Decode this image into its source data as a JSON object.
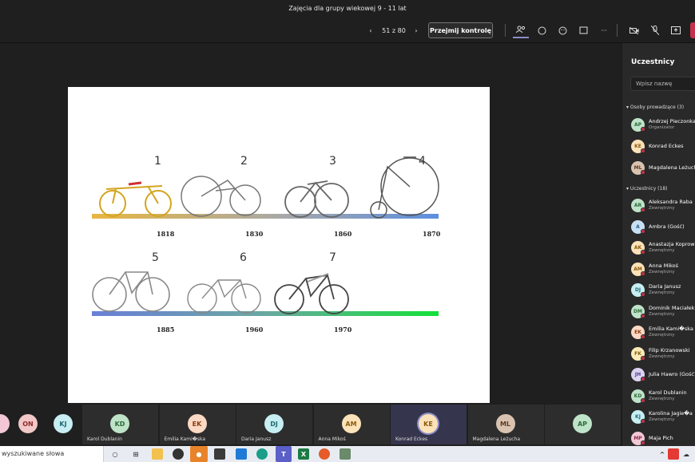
{
  "window": {
    "title": "Zajęcia dla grupy wiekowej 9 - 11 lat"
  },
  "toolbar": {
    "page_counter": "51 z 80",
    "takeover_label": "Przejmij kontrolę",
    "more_label": "···"
  },
  "slide": {
    "numbers": [
      "1",
      "2",
      "3",
      "4",
      "5",
      "6",
      "7"
    ],
    "years": [
      "1818",
      "1830",
      "1860",
      "1870",
      "1885",
      "1960",
      "1970"
    ]
  },
  "panel": {
    "title": "Uczestnicy",
    "search_placeholder": "Wpisz nazwę",
    "presenters_label": "Osoby prowadzące (3)",
    "attendees_label": "Uczestnicy (18)",
    "presenters": [
      {
        "initials": "AP",
        "name": "Andrzej Pieczonka",
        "sub": "Organizator",
        "color": "#bfe3c8",
        "fg": "#2d6b3c"
      },
      {
        "initials": "KE",
        "name": "Konrad Eckes",
        "sub": "",
        "color": "#fce2b8",
        "fg": "#8a5a10"
      },
      {
        "initials": "ML",
        "name": "Magdalena Leżuch",
        "sub": "",
        "color": "#d9c3b0",
        "fg": "#5a3a20"
      }
    ],
    "attendees": [
      {
        "initials": "AR",
        "name": "Aleksandra Raba",
        "sub": "Zewnętrzny",
        "color": "#bfe3c8",
        "fg": "#2d6b3c"
      },
      {
        "initials": "A",
        "name": "Ambra (Gość)",
        "sub": "",
        "color": "#c7dff2",
        "fg": "#2a5f8f"
      },
      {
        "initials": "AK",
        "name": "Anastazja Koprow",
        "sub": "Zewnętrzny",
        "color": "#fce2b8",
        "fg": "#8a5a10"
      },
      {
        "initials": "AM",
        "name": "Anna Mikoś",
        "sub": "Zewnętrzny",
        "color": "#fce2b8",
        "fg": "#8a5a10"
      },
      {
        "initials": "DJ",
        "name": "Daria Janusz",
        "sub": "Zewnętrzny",
        "color": "#c7eef2",
        "fg": "#1f6a73"
      },
      {
        "initials": "DM",
        "name": "Dominik Maciałek",
        "sub": "Zewnętrzny",
        "color": "#bfe3c8",
        "fg": "#2d6b3c"
      },
      {
        "initials": "EK",
        "name": "Emilia Kami�ska",
        "sub": "Zewnętrzny",
        "color": "#fcd9c4",
        "fg": "#8a3c10"
      },
      {
        "initials": "FK",
        "name": "Filip Krzanowski",
        "sub": "Zewnętrzny",
        "color": "#fcebb8",
        "fg": "#7a6010"
      },
      {
        "initials": "JH",
        "name": "Julia Hawro (Gość)",
        "sub": "",
        "color": "#dcd3f2",
        "fg": "#4a3a8f"
      },
      {
        "initials": "KD",
        "name": "Karol Dublanin",
        "sub": "Zewnętrzny",
        "color": "#bfe3c8",
        "fg": "#2d6b3c"
      },
      {
        "initials": "KJ",
        "name": "Karolina Jagie�a",
        "sub": "Zewnętrzny",
        "color": "#c7eef2",
        "fg": "#1f6a73"
      },
      {
        "initials": "MP",
        "name": "Maja Pich",
        "sub": "",
        "color": "#f2c7d6",
        "fg": "#8f2a52"
      }
    ]
  },
  "gallery": {
    "left_avatars": [
      {
        "initials": "",
        "color": "#f2c7d6",
        "fg": "#8f2a52"
      },
      {
        "initials": "ON",
        "color": "#f2c7c7",
        "fg": "#8f2a2a"
      },
      {
        "initials": "KJ",
        "color": "#c7eef2",
        "fg": "#1f6a73"
      }
    ],
    "tiles": [
      {
        "initials": "KD",
        "name": "Karol Dublanin",
        "color": "#bfe3c8",
        "fg": "#2d6b3c"
      },
      {
        "initials": "EK",
        "name": "Emilia Kami�ska",
        "color": "#fcd9c4",
        "fg": "#8a3c10"
      },
      {
        "initials": "DJ",
        "name": "Daria Janusz",
        "color": "#c7eef2",
        "fg": "#1f6a73"
      },
      {
        "initials": "AM",
        "name": "Anna Mikoś",
        "color": "#fce2b8",
        "fg": "#8a5a10"
      },
      {
        "initials": "KE",
        "name": "Konrad Eckes",
        "color": "#fce2b8",
        "fg": "#8a5a10"
      },
      {
        "initials": "ML",
        "name": "Magdalena Leżucha",
        "color": "#d9c3b0",
        "fg": "#5a3a20"
      },
      {
        "initials": "AP",
        "name": "",
        "color": "#bfe3c8",
        "fg": "#2d6b3c"
      }
    ]
  },
  "taskbar": {
    "search_text": "wyszukiwane słowa"
  }
}
